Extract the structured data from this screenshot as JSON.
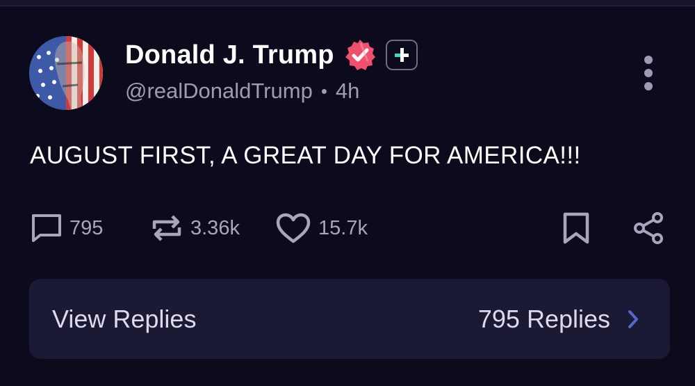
{
  "post": {
    "author": {
      "display_name": "Donald J. Trump",
      "handle": "@realDonaldTrump",
      "separator": "•",
      "time_ago": "4h",
      "verified_icon": "verified-badge-icon",
      "plus_icon": "plus-badge-icon"
    },
    "text": "AUGUST FIRST, A GREAT DAY FOR AMERICA!!!",
    "actions": {
      "replies": "795",
      "reposts": "3.36k",
      "likes": "15.7k"
    },
    "view_replies": {
      "label": "View Replies",
      "count_label": "795 Replies"
    }
  },
  "colors": {
    "background": "#0c0b1e",
    "card": "#1a1a35",
    "verified": "#f0506e",
    "plus_accent": "#3fd9c1",
    "muted_text": "#9d9cb4",
    "chevron": "#5a63c9"
  }
}
